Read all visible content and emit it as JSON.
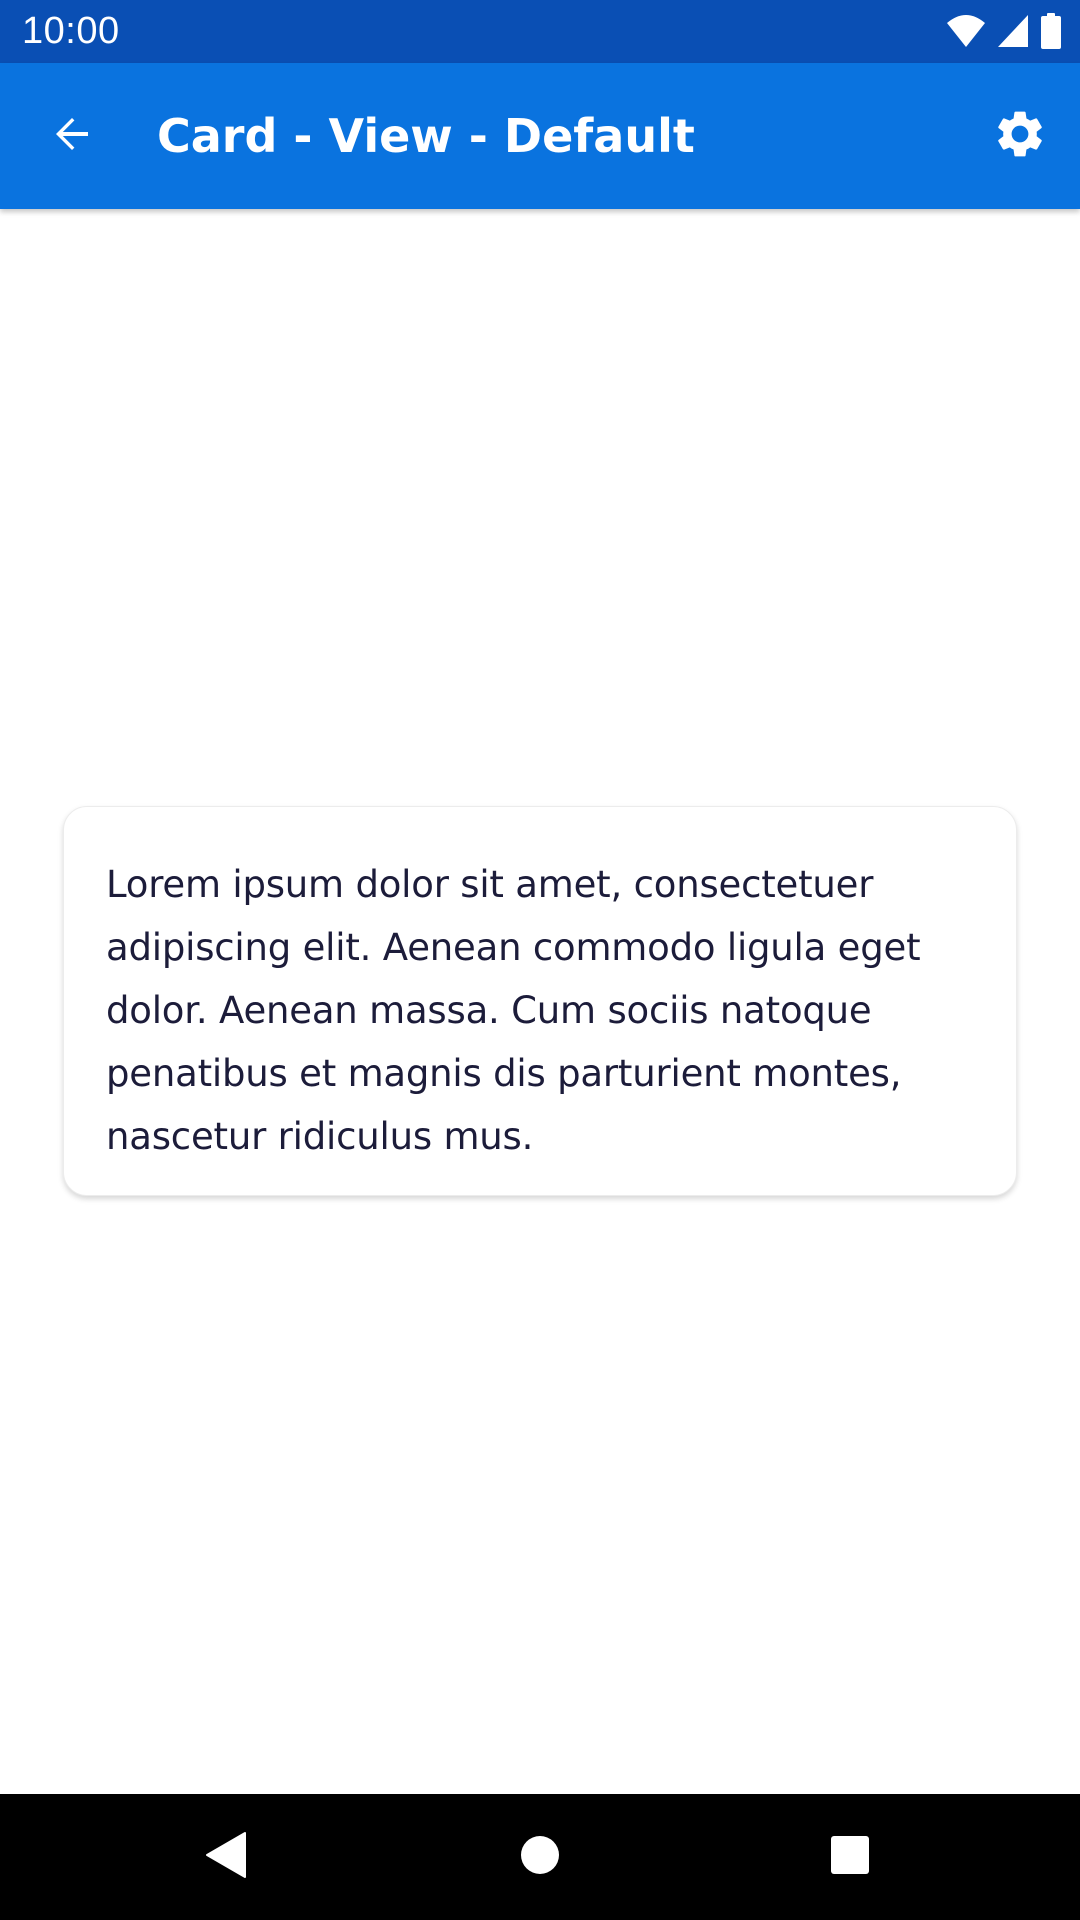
{
  "status_bar": {
    "time": "10:00",
    "icons": [
      "wifi-icon",
      "signal-icon",
      "battery-icon"
    ],
    "color": "#0a4fb4"
  },
  "app_bar": {
    "title": "Card - View - Default",
    "back_icon": "arrow-back-icon",
    "settings_icon": "gear-icon",
    "color": "#0a73df"
  },
  "card": {
    "text": "Lorem ipsum dolor sit amet, consectetuer adipiscing elit. Aenean commodo ligula eget dolor. Aenean massa. Cum sociis natoque penatibus et magnis dis parturient montes, nascetur ridiculus mus.",
    "text_color": "#1c1c3a"
  },
  "nav_bar": {
    "icons": [
      "back-triangle-icon",
      "home-circle-icon",
      "recents-square-icon"
    ]
  }
}
